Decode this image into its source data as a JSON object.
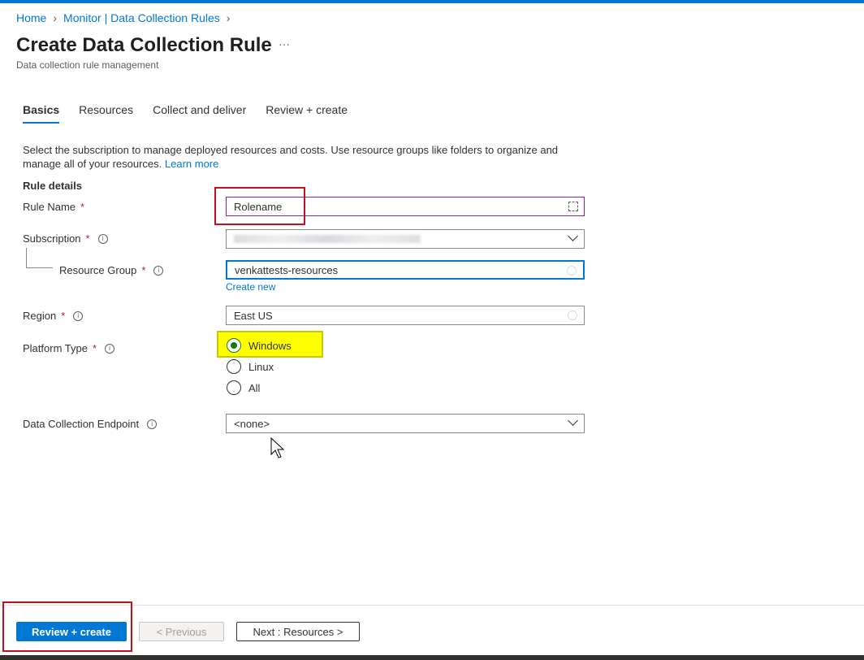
{
  "breadcrumb": {
    "items": [
      "Home",
      "Monitor | Data Collection Rules"
    ]
  },
  "header": {
    "title": "Create Data Collection Rule",
    "more": "···",
    "subtitle": "Data collection rule management"
  },
  "tabs": [
    {
      "label": "Basics",
      "active": true
    },
    {
      "label": "Resources"
    },
    {
      "label": "Collect and deliver"
    },
    {
      "label": "Review + create"
    }
  ],
  "description": {
    "text": "Select the subscription to manage deployed resources and costs. Use resource groups like folders to organize and manage all of your resources.",
    "link": "Learn more"
  },
  "section_title": "Rule details",
  "fields": {
    "rule_name": {
      "label": "Rule Name",
      "value": "Rolename"
    },
    "subscription": {
      "label": "Subscription"
    },
    "resource_group": {
      "label": "Resource Group",
      "value": "venkattests-resources",
      "create_new": "Create new"
    },
    "region": {
      "label": "Region",
      "value": "East US"
    },
    "platform_type": {
      "label": "Platform Type",
      "options": [
        "Windows",
        "Linux",
        "All"
      ],
      "selected": "Windows"
    },
    "endpoint": {
      "label": "Data Collection Endpoint",
      "value": "<none>"
    }
  },
  "footer": {
    "review": "Review + create",
    "previous": "< Previous",
    "next": "Next : Resources >"
  },
  "colors": {
    "accent": "#0078d4",
    "highlight": "#ffff00",
    "annotation": "#c50f1f"
  }
}
